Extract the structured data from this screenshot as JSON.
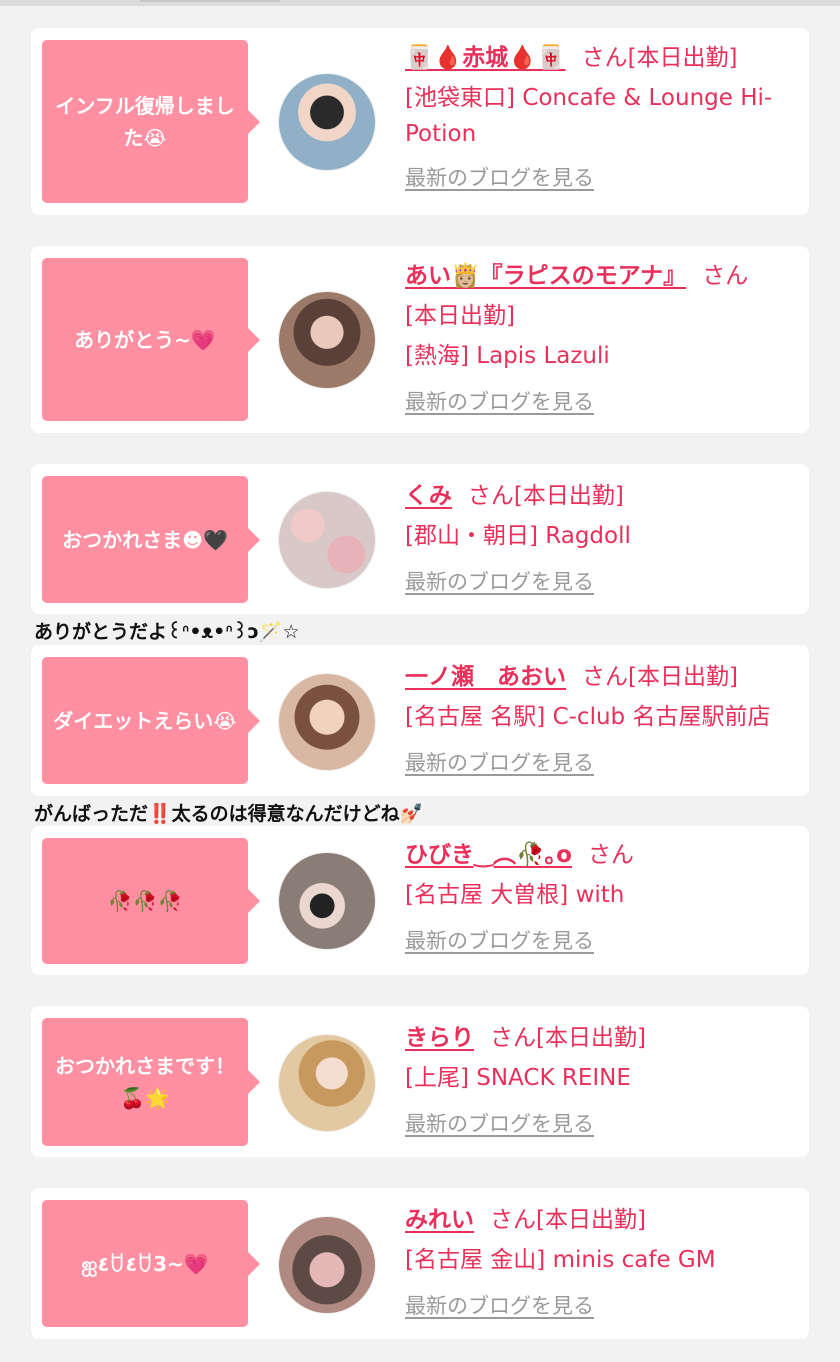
{
  "cards": [
    {
      "bubble": "インフル復帰しました😭",
      "name": "🀄🩸赤城🩸🀄",
      "san": "さん",
      "status": "[本日出勤]",
      "shop": "[池袋東口] Concafe & Lounge Hi-Potion",
      "blog_link": "最新のブログを見る",
      "avatar_color": "#8fb0c6"
    },
    {
      "bubble": "ありがとう~💗",
      "name": "あい👸🏼『ラピスのモアナ』",
      "san": "さん",
      "status": "[本日出勤]",
      "shop": "[熱海] Lapis Lazuli",
      "blog_link": "最新のブログを見る",
      "avatar_color": "#9b7a6a"
    },
    {
      "bubble": "おつかれさま☻🖤",
      "name": "くみ",
      "san": "さん",
      "status": "[本日出勤]",
      "shop": "[郡山・朝日] Ragdoll",
      "blog_link": "最新のブログを見る",
      "avatar_color": "#d8b8b8"
    },
    {
      "comment": "ありがとうだよ꒰ᐢ•ᴥ•ᐢ꒱ɔ🪄☆",
      "bubble": "ダイエットえらい😭",
      "name": "一ノ瀬　あおい",
      "san": "さん",
      "status": "[本日出勤]",
      "shop": "[名古屋 名駅] C-club 名古屋駅前店",
      "blog_link": "最新のブログを見る",
      "avatar_color": "#c9a38c"
    },
    {
      "comment": "がんばっただ‼️太るのは得意なんだけどね💅🏻",
      "bubble": "🥀🥀🥀",
      "name": "ひびき‿︵🥀｡o",
      "san": "さん",
      "status": "",
      "shop": "[名古屋 大曽根] with",
      "blog_link": "最新のブログを見る",
      "avatar_color": "#8a7d76"
    },
    {
      "bubble": "おつかれさまです！🍒🌟",
      "name": "きらり",
      "san": "さん",
      "status": "[本日出勤]",
      "shop": "[上尾] SNACK REINE",
      "blog_link": "最新のブログを見る",
      "avatar_color": "#e3c9a1"
    },
    {
      "bubble": "ஐ٤ꇴ٤ꇴ3~💗",
      "name": "みれい",
      "san": "さん",
      "status": "[本日出勤]",
      "shop": "[名古屋 金山] minis cafe GM",
      "blog_link": "最新のブログを見る",
      "avatar_color": "#b08a80"
    }
  ]
}
